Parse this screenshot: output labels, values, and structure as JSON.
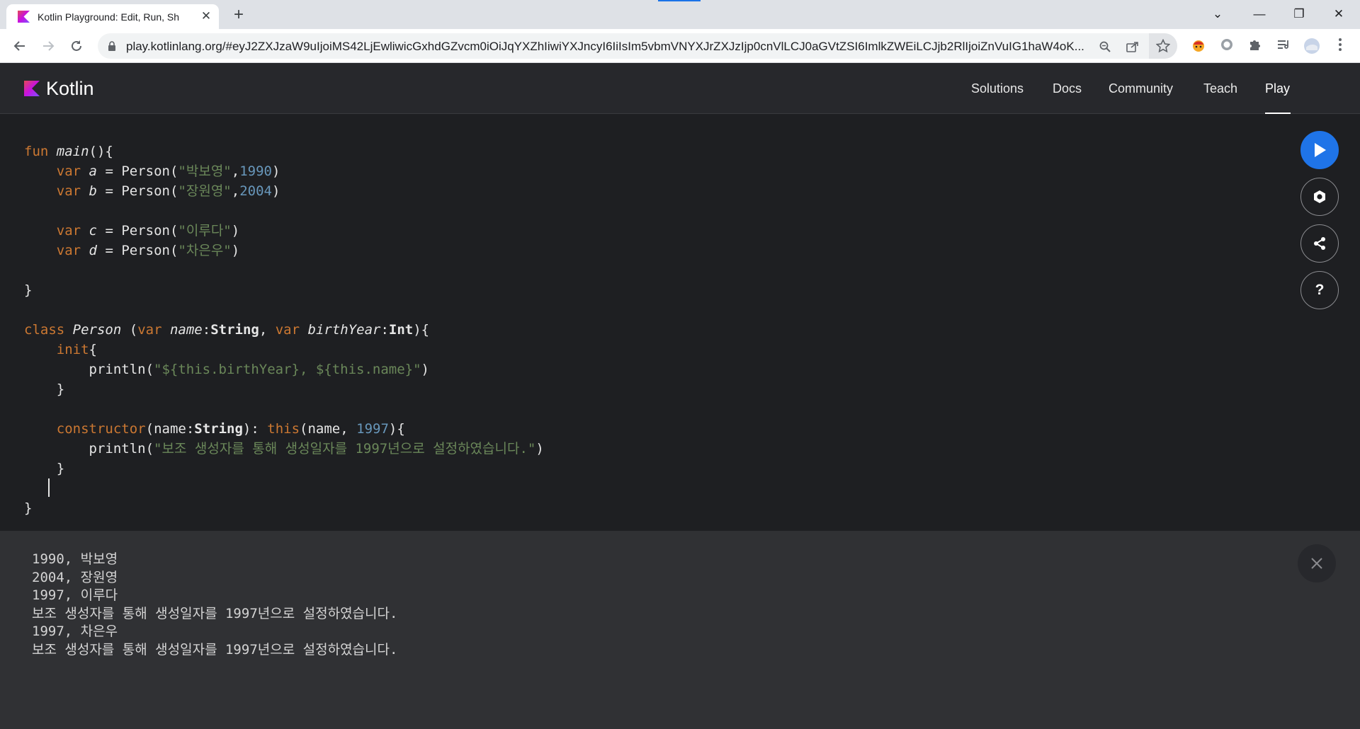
{
  "browser": {
    "tab_title": "Kotlin Playground: Edit, Run, Sh",
    "tab_close": "✕",
    "new_tab": "+",
    "url": "play.kotlinlang.org/#eyJ2ZXJzaW9uIjoiMS42LjEwliwicGxhdGZvcm0iOiJqYXZhIiwiYXJncyI6IiIsIm5vbmVNYXJrZXJzIjp0cnVlLCJ0aGVtZSI6ImlkZWEiLCJjb2RlIjoiZnVuIG1haW4oK...",
    "controls": {
      "minimize": "—",
      "restore": "❐",
      "close": "✕",
      "tab_search": "⌄"
    }
  },
  "site": {
    "brand": "Kotlin",
    "nav": [
      {
        "label": "Solutions"
      },
      {
        "label": "Docs"
      },
      {
        "label": "Community"
      },
      {
        "label": "Teach"
      },
      {
        "label": "Play",
        "active": true
      }
    ]
  },
  "editor": {
    "code": "fun main(){\n    var a = Person(\"박보영\",1990)\n    var b = Person(\"장원영\",2004)\n\n    var c = Person(\"이루다\")\n    var d = Person(\"차은우\")\n\n}\n\nclass Person (var name:String, var birthYear:Int){\n    init{\n        println(\"${this.birthYear}, ${this.name}\")\n    }\n\n    constructor(name:String): this(name, 1997){\n        println(\"보조 생성자를 통해 생성일자를 1997년으로 설정하였습니다.\")\n    }\n\n}",
    "tokens": {
      "fun": "fun",
      "main": "main",
      "var": "var",
      "a": "a",
      "b": "b",
      "c": "c",
      "d": "d",
      "person": "Person",
      "s1": "\"박보영\"",
      "n1": "1990",
      "s2": "\"장원영\"",
      "n2": "2004",
      "s3": "\"이루다\"",
      "s4": "\"차은우\"",
      "class": "class",
      "name": "name",
      "birthYear": "birthYear",
      "String": "String",
      "Int": "Int",
      "init": "init",
      "println": "println",
      "s5": "\"${this.birthYear}, ${this.name}\"",
      "constructor": "constructor",
      "this": "this",
      "n3": "1997",
      "s6": "\"보조 생성자를 통해 생성일자를 1997년으로 설정하였습니다.\""
    }
  },
  "actions": {
    "run": "run-icon",
    "settings": "gear-icon",
    "share": "share-icon",
    "help": "?"
  },
  "output": {
    "lines": "1990, 박보영\n2004, 장원영\n1997, 이루다\n보조 생성자를 통해 생성일자를 1997년으로 설정하였습니다.\n1997, 차은우\n보조 생성자를 통해 생성일자를 1997년으로 설정하였습니다."
  },
  "colors": {
    "keyword": "#cc7832",
    "string": "#6a8759",
    "number": "#6897bb",
    "run_button": "#1f74e8",
    "editor_bg": "#1e1f22",
    "output_bg": "#303134"
  }
}
